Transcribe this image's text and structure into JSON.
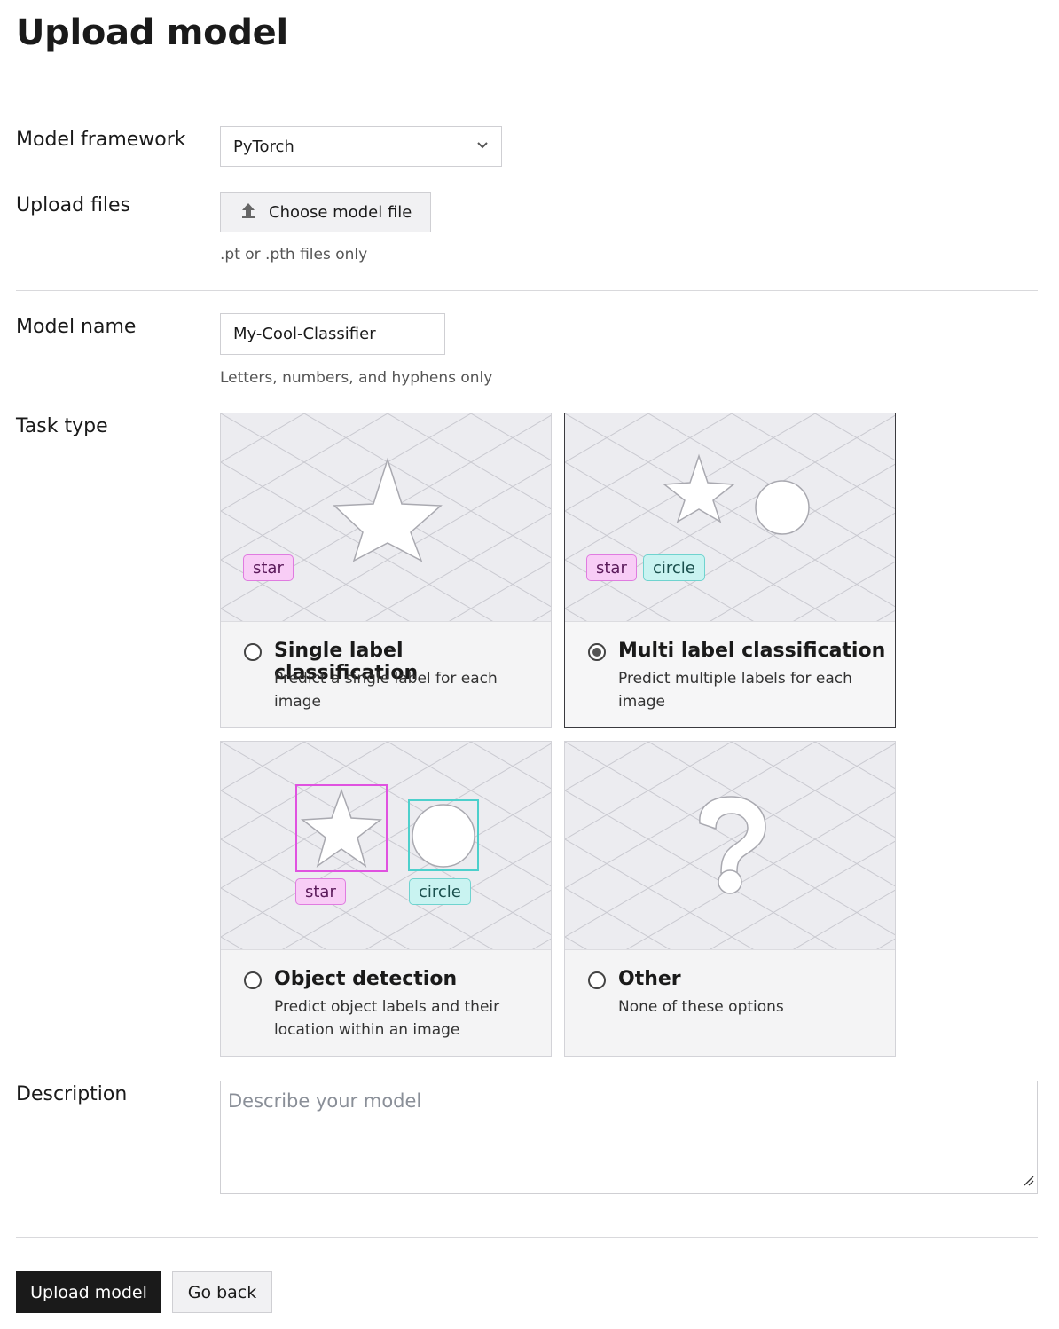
{
  "page": {
    "title": "Upload model"
  },
  "framework": {
    "label": "Model framework",
    "value": "PyTorch"
  },
  "upload": {
    "label": "Upload files",
    "button_label": "Choose model file",
    "help": ".pt or .pth files only"
  },
  "model_name": {
    "label": "Model name",
    "value": "My-Cool-Classifier",
    "help": "Letters, numbers, and hyphens only"
  },
  "task_type": {
    "label": "Task type",
    "selected": "Multi label classification",
    "options": [
      {
        "title": "Single label classification",
        "description": "Predict a single label for each image",
        "tags": [
          "star"
        ],
        "selected": false
      },
      {
        "title": "Multi label classification",
        "description": "Predict multiple labels for each image",
        "tags": [
          "star",
          "circle"
        ],
        "selected": true
      },
      {
        "title": "Object detection",
        "description": "Predict object labels and their location within an image",
        "tags": [
          "star",
          "circle"
        ],
        "selected": false
      },
      {
        "title": "Other",
        "description": "None of these options",
        "tags": [],
        "selected": false
      }
    ]
  },
  "description": {
    "label": "Description",
    "placeholder": "Describe your model",
    "value": ""
  },
  "actions": {
    "submit_label": "Upload model",
    "back_label": "Go back"
  },
  "colors": {
    "primary_button": "#1a1a1a",
    "tag_pink": "#f8cdf6",
    "tag_cyan": "#c9f3f1",
    "box_magenta": "#e052e0",
    "box_cyan": "#4dd0cc"
  },
  "icons": {
    "select_chevron": "chevron-down-icon",
    "upload": "upload-icon"
  }
}
